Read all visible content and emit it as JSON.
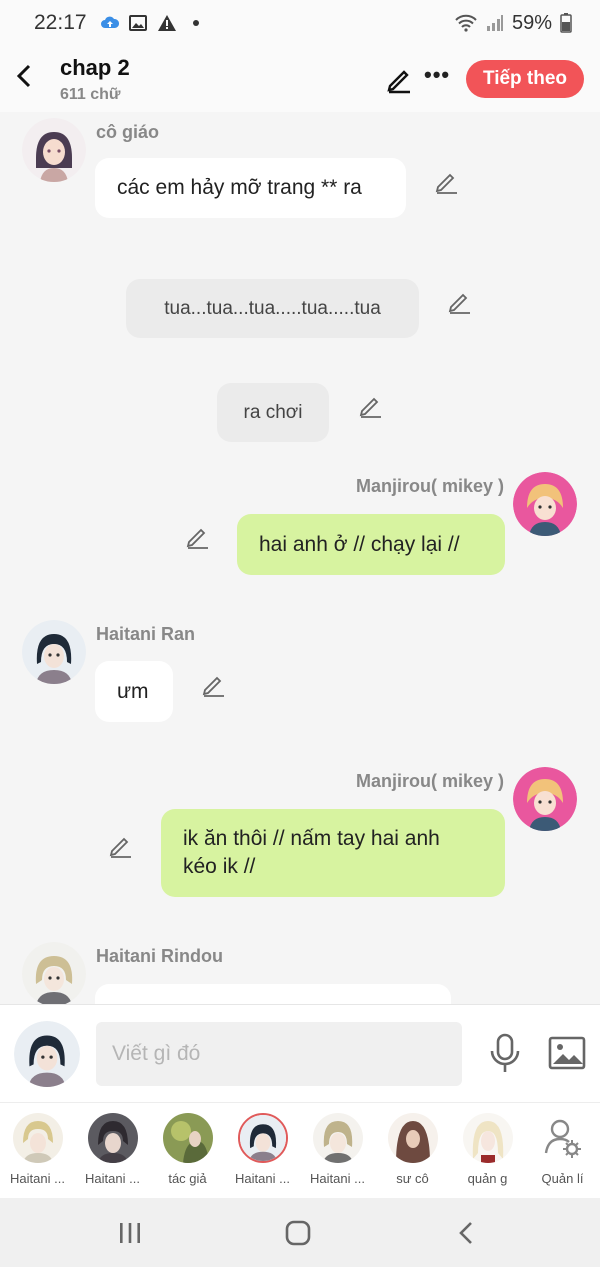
{
  "status_bar": {
    "time": "22:17",
    "battery": "59%"
  },
  "header": {
    "title": "chap 2",
    "subtitle": "611 chữ",
    "next_label": "Tiếp theo"
  },
  "messages": [
    {
      "sender": "cô giáo",
      "text": "các em hảy mỡ trang ** ra"
    },
    {
      "text": "tua...tua...tua.....tua.....tua"
    },
    {
      "text": "ra chơi"
    },
    {
      "sender": "Manjirou( mikey )",
      "text": "hai anh ở // chạy lại //"
    },
    {
      "sender": "Haitani Ran",
      "text": "ưm"
    },
    {
      "sender": "Manjirou( mikey )",
      "text_line1": "ik ăn thôi // nấm tay hai anh",
      "text_line2": "kéo ik //"
    },
    {
      "sender": "Haitani Rindou",
      "text": ""
    }
  ],
  "composer": {
    "placeholder": "Viết gì đó"
  },
  "characters": [
    {
      "label": "Haitani ..."
    },
    {
      "label": "Haitani ..."
    },
    {
      "label": "tác giả"
    },
    {
      "label": "Haitani ..."
    },
    {
      "label": "Haitani ..."
    },
    {
      "label": "sư cô"
    },
    {
      "label": "quản g"
    },
    {
      "label": "Quản lí"
    }
  ],
  "colors": {
    "accent": "#f25458",
    "sent_bubble": "#d7f3a0",
    "received_bubble": "#ffffff",
    "narration_bubble": "#ebebeb"
  }
}
